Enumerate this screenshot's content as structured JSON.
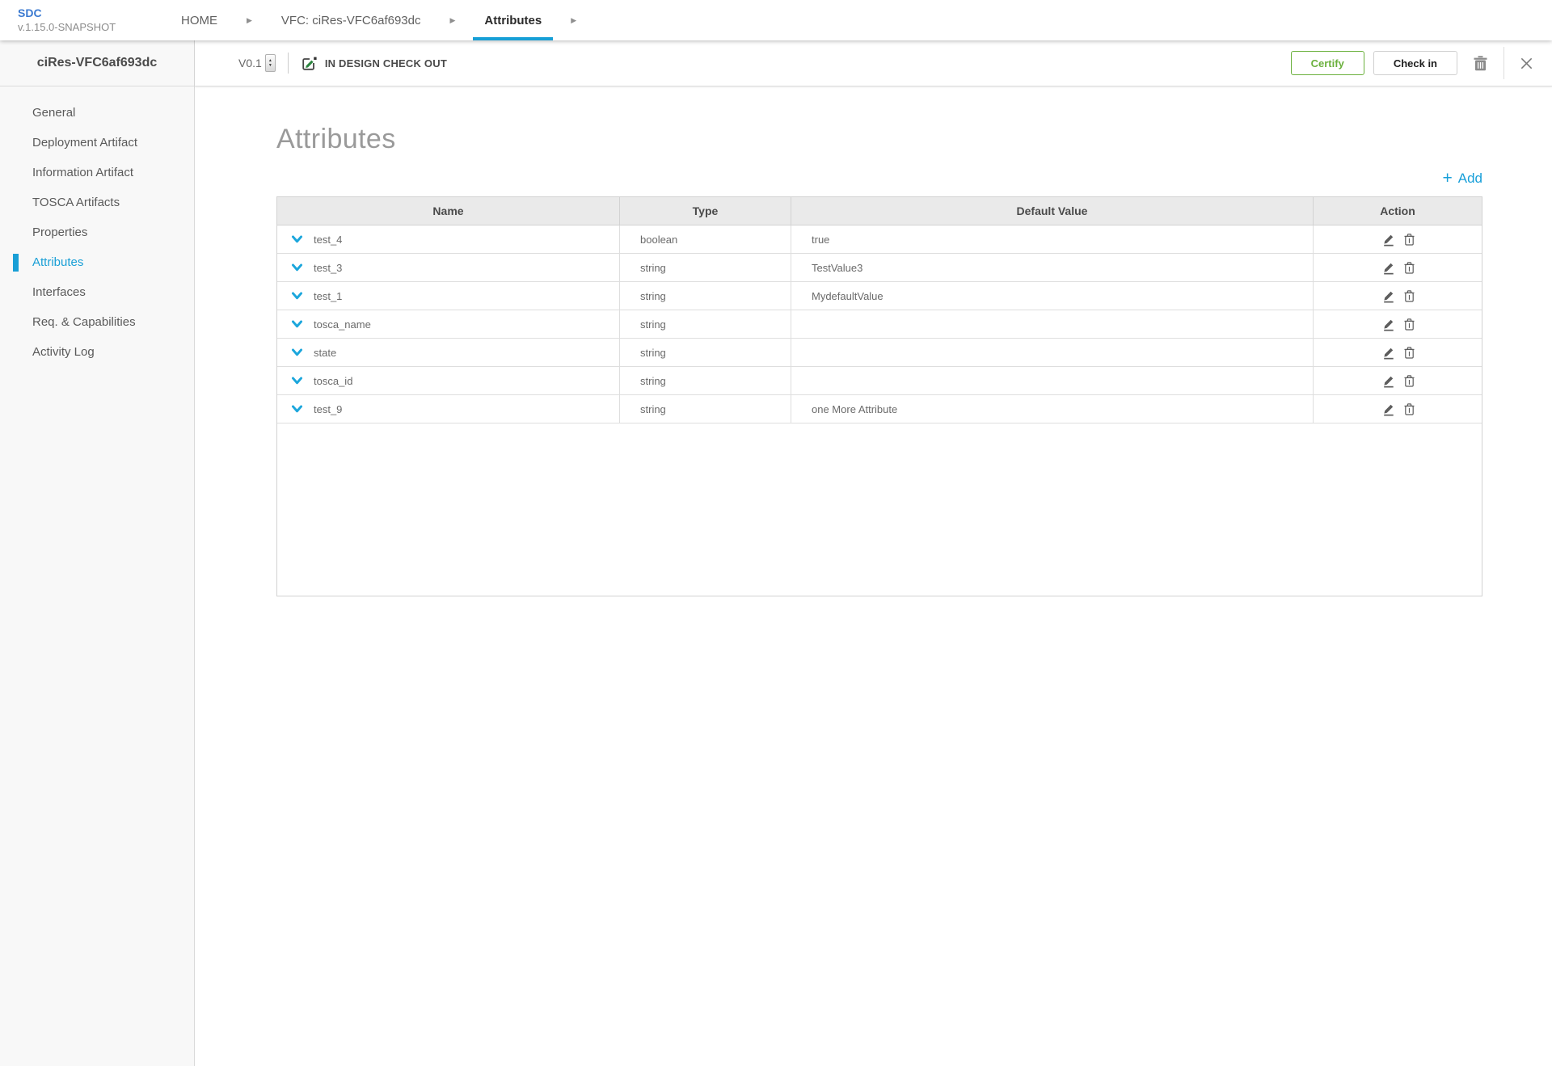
{
  "app": {
    "name": "SDC",
    "version_label": "v.1.15.0-SNAPSHOT"
  },
  "breadcrumb": {
    "home": "HOME",
    "vfc": "VFC: ciRes-VFC6af693dc",
    "current": "Attributes"
  },
  "workspace": {
    "entity_name": "ciRes-VFC6af693dc",
    "version": "V0.1",
    "lifecycle_state": "IN DESIGN CHECK OUT",
    "certify_label": "Certify",
    "checkin_label": "Check in"
  },
  "sidebar": {
    "items": [
      {
        "label": "General"
      },
      {
        "label": "Deployment Artifact"
      },
      {
        "label": "Information Artifact"
      },
      {
        "label": "TOSCA Artifacts"
      },
      {
        "label": "Properties"
      },
      {
        "label": "Attributes",
        "active": true
      },
      {
        "label": "Interfaces"
      },
      {
        "label": "Req. & Capabilities"
      },
      {
        "label": "Activity Log"
      }
    ]
  },
  "main": {
    "title": "Attributes",
    "add_label": "Add",
    "add_plus": "+"
  },
  "attributes_table": {
    "columns": [
      "Name",
      "Type",
      "Default Value",
      "Action"
    ],
    "rows": [
      {
        "name": "test_4",
        "type": "boolean",
        "default_value": "true"
      },
      {
        "name": "test_3",
        "type": "string",
        "default_value": "TestValue3"
      },
      {
        "name": "test_1",
        "type": "string",
        "default_value": "MydefaultValue"
      },
      {
        "name": "tosca_name",
        "type": "string",
        "default_value": ""
      },
      {
        "name": "state",
        "type": "string",
        "default_value": ""
      },
      {
        "name": "tosca_id",
        "type": "string",
        "default_value": ""
      },
      {
        "name": "test_9",
        "type": "string",
        "default_value": "one More Attribute"
      }
    ]
  },
  "icons": {
    "breadcrumb_arrow": "▶",
    "spinner_up": "▲",
    "spinner_down": "▼"
  },
  "colors": {
    "accent_blue": "#199fd6",
    "logo_blue": "#3b7ad1",
    "certify_green": "#6ab03c",
    "checkout_pencil_green": "#2d8540"
  }
}
